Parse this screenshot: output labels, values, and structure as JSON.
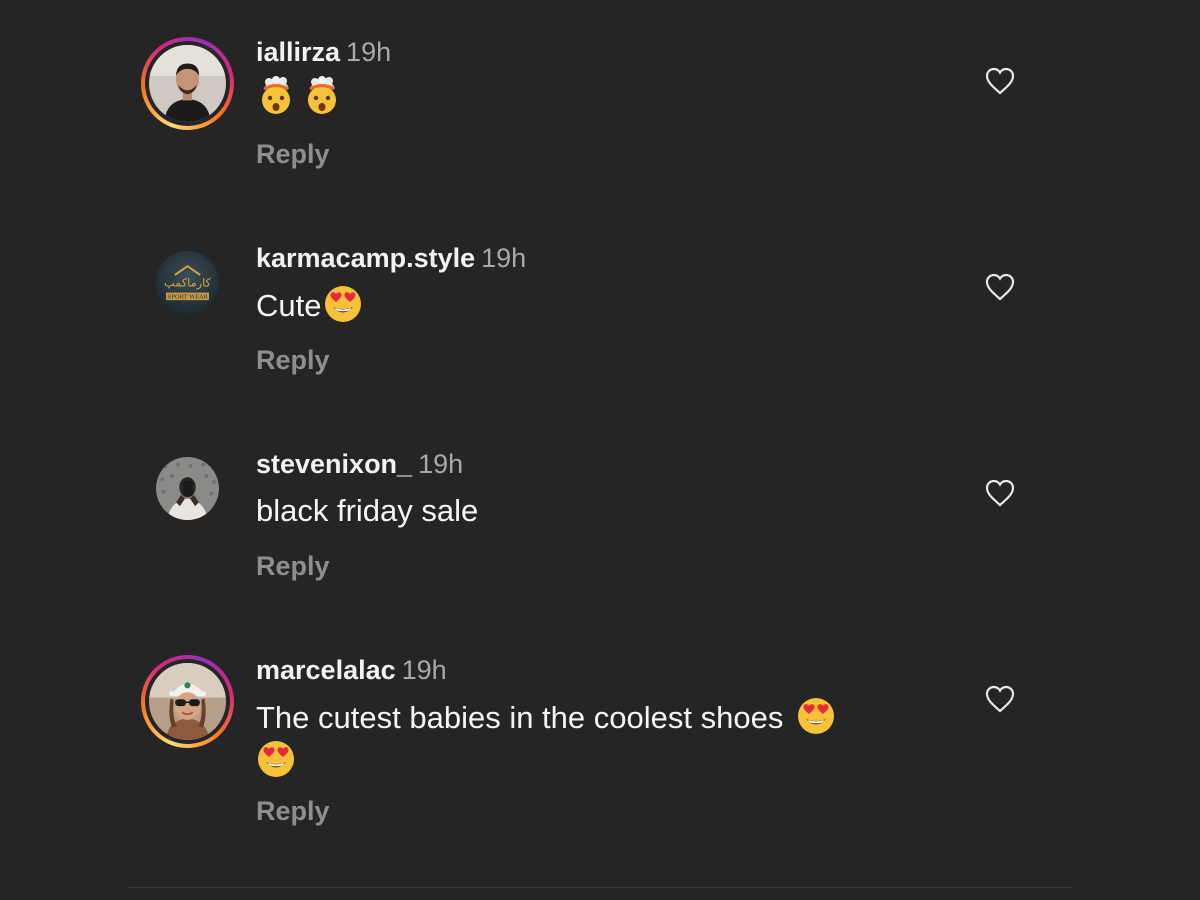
{
  "colors": {
    "background": "#252525",
    "username": "#f2f2f2",
    "timestamp": "#a8a8a8",
    "reply": "#8e8e8e",
    "story_ring": [
      "#feda75",
      "#fa7e1e",
      "#d62976",
      "#962fbf"
    ]
  },
  "comments": [
    {
      "username": "iallirza",
      "time": "19h",
      "text": "",
      "emojis": [
        "exploding-head-emoji",
        "exploding-head-emoji"
      ],
      "reply_label": "Reply",
      "has_story_ring": true,
      "like_icon": "heart-outline-icon"
    },
    {
      "username": "karmacamp.style",
      "time": "19h",
      "text": "Cute",
      "emojis": [
        "heart-eyes-emoji"
      ],
      "reply_label": "Reply",
      "has_story_ring": false,
      "avatar_logo_text": "کارماکمپ",
      "avatar_logo_subtext": "SPORT WEAR",
      "like_icon": "heart-outline-icon"
    },
    {
      "username": "stevenixon_",
      "time": "19h",
      "text": "black friday sale",
      "emojis": [],
      "reply_label": "Reply",
      "has_story_ring": false,
      "like_icon": "heart-outline-icon"
    },
    {
      "username": "marcelalac",
      "time": "19h",
      "text": "The cutest babies in the coolest shoes",
      "emojis": [
        "heart-eyes-emoji",
        "heart-eyes-emoji"
      ],
      "reply_label": "Reply",
      "has_story_ring": true,
      "like_icon": "heart-outline-icon"
    }
  ]
}
